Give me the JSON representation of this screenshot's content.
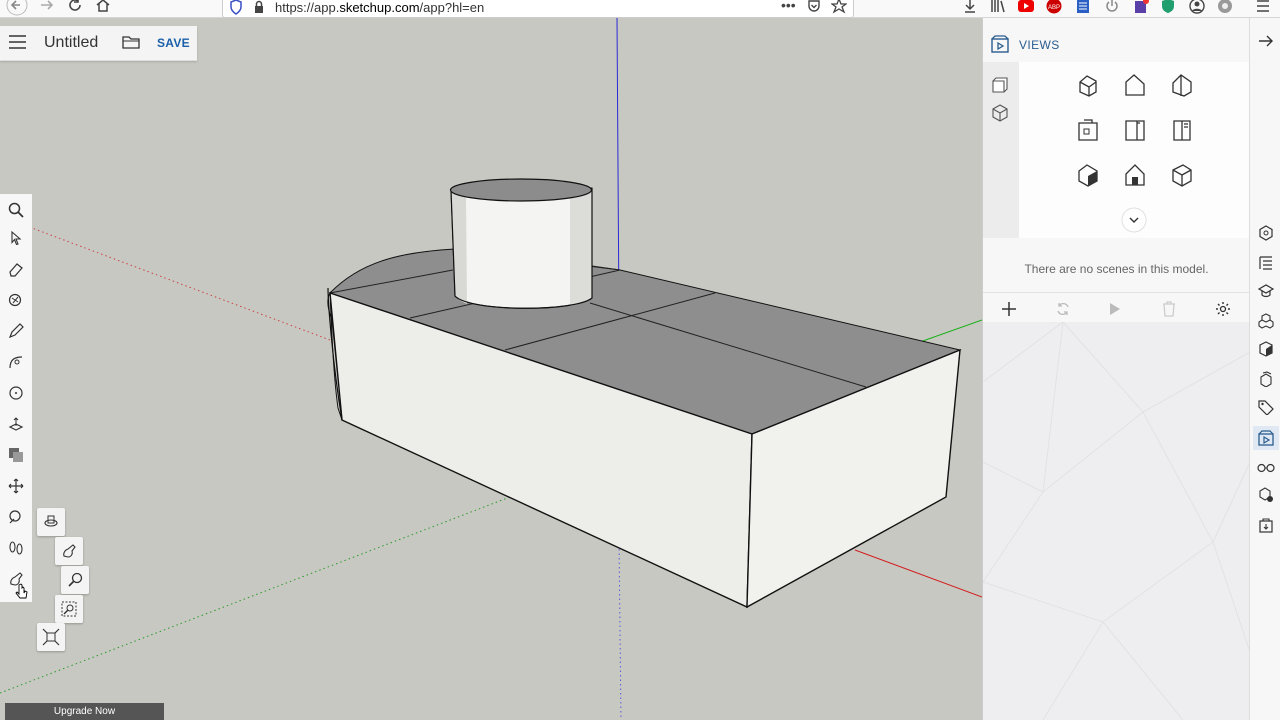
{
  "browser": {
    "url_prefix": "https://app.",
    "url_domain": "sketchup.com",
    "url_suffix": "/app?hl=en",
    "menu_icon": "hamburger-icon"
  },
  "app": {
    "document_title": "Untitled",
    "save_label": "SAVE"
  },
  "views_panel": {
    "title": "VIEWS",
    "no_scenes_text": "There are no scenes in this model."
  },
  "upgrade": {
    "label": "Upgrade Now"
  },
  "colors": {
    "axis_blue": "#2a2ad8",
    "axis_red": "#d22020",
    "axis_green": "#19b019",
    "accent": "#1a5fa8",
    "background": "#c8c8c2"
  }
}
